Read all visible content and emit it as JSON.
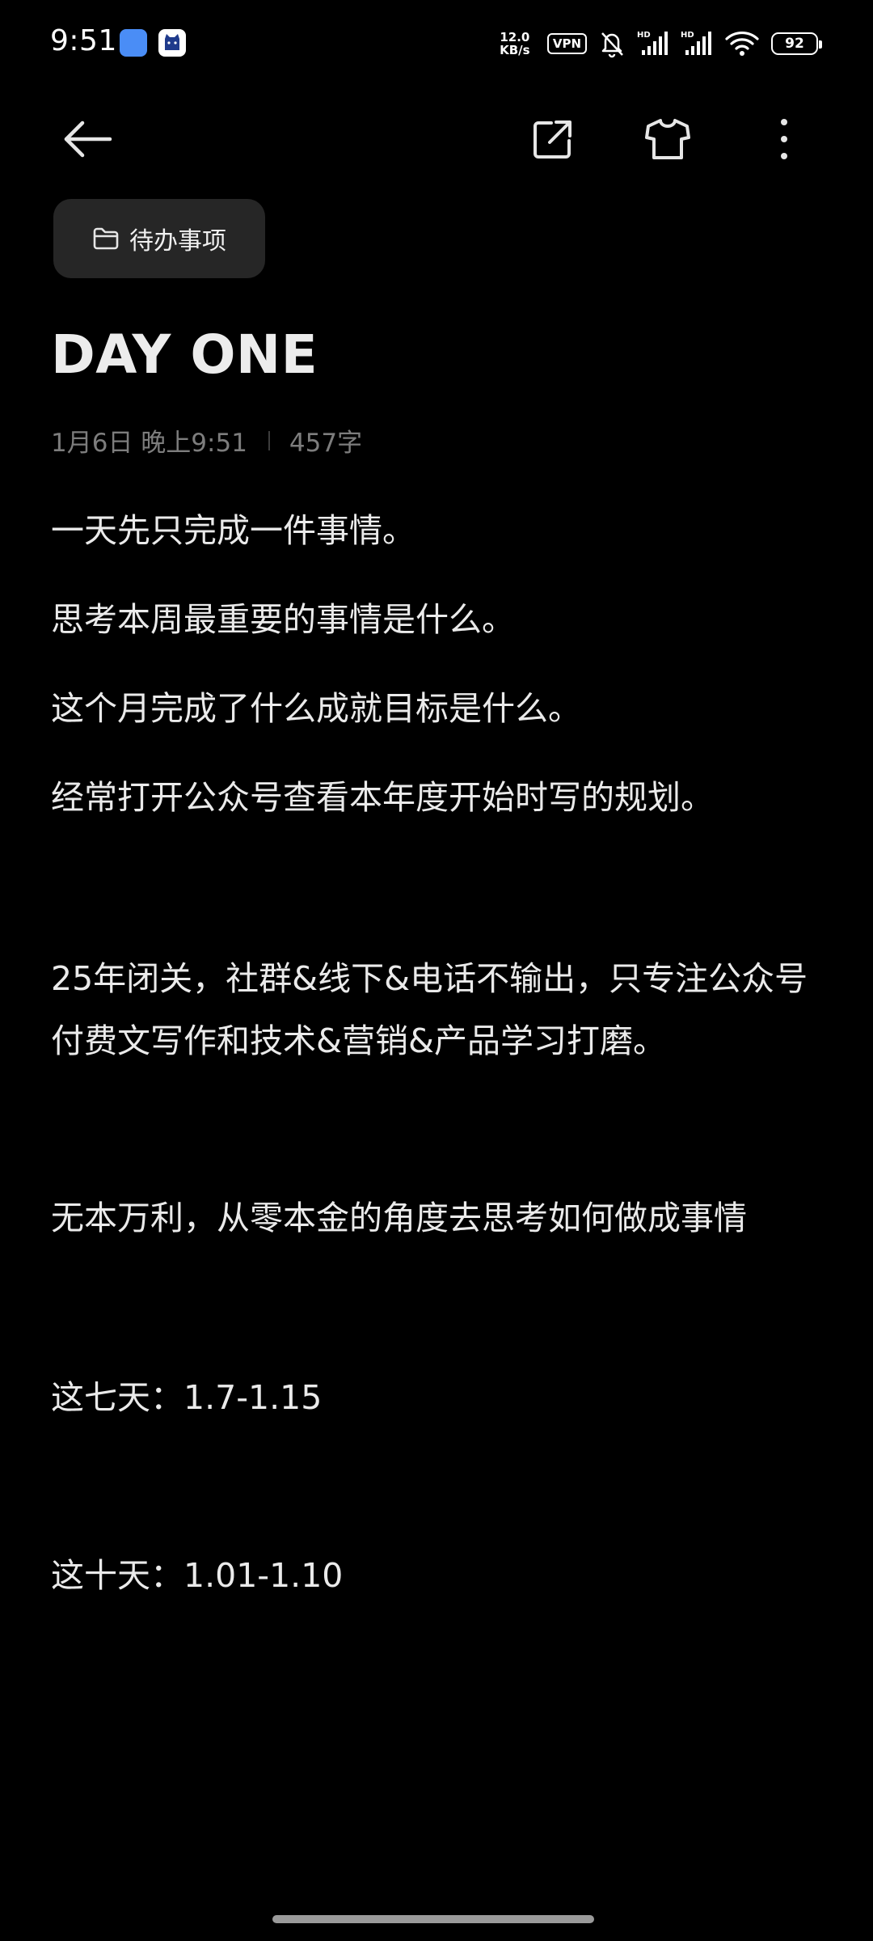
{
  "status_bar": {
    "time": "9:51",
    "net_speed_value": "12.0",
    "net_speed_unit": "KB/s",
    "vpn": "VPN",
    "battery": "92"
  },
  "toolbar": {
    "back_icon": "back-arrow-icon",
    "share_icon": "share-icon",
    "theme_icon": "shirt-icon",
    "more_icon": "more-vertical-icon"
  },
  "note": {
    "folder": "待办事项",
    "title": "DAY ONE",
    "date": "1月6日 晚上9:51",
    "word_count": "457字",
    "lines": {
      "l1": "一天先只完成一件事情。",
      "l2": "思考本周最重要的事情是什么。",
      "l3": "这个月完成了什么成就目标是什么。",
      "l4": "经常打开公众号查看本年度开始时写的规划。",
      "l5": "25年闭关，社群&线下&电话不输出，只专注公众号付费文写作和技术&营销&产品学习打磨。",
      "l6": "无本万利，从零本金的角度去思考如何做成事情",
      "l7": "这七天：1.7-1.15",
      "l8": "这十天：1.01-1.10"
    }
  }
}
